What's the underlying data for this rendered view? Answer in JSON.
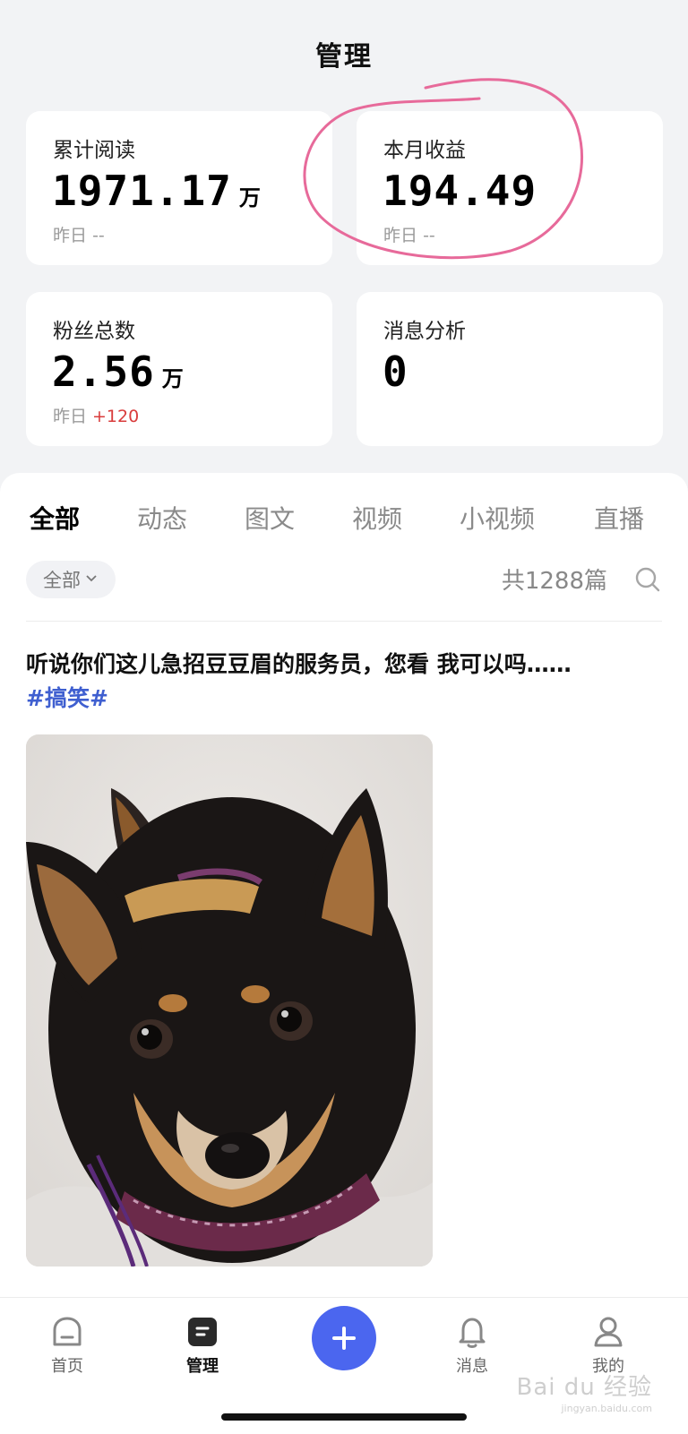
{
  "header": {
    "title": "管理"
  },
  "stats": {
    "reads": {
      "label": "累计阅读",
      "value": "1971.17",
      "unit": "万",
      "sub_label": "昨日",
      "sub_value": "--"
    },
    "income": {
      "label": "本月收益",
      "value": "194.49",
      "sub_label": "昨日",
      "sub_value": "--"
    },
    "fans": {
      "label": "粉丝总数",
      "value": "2.56",
      "unit": "万",
      "sub_label": "昨日",
      "sub_value": "+120"
    },
    "messages": {
      "label": "消息分析",
      "value": "0"
    }
  },
  "content": {
    "tabs": [
      {
        "label": "全部"
      },
      {
        "label": "动态"
      },
      {
        "label": "图文"
      },
      {
        "label": "视频"
      },
      {
        "label": "小视频"
      },
      {
        "label": "直播"
      }
    ],
    "filter_label": "全部",
    "count_text": "共1288篇",
    "post": {
      "title": "听说你们这儿急招豆豆眉的服务员，您看 我可以吗……",
      "tag": "#搞笑#"
    }
  },
  "tabbar": {
    "items": [
      {
        "label": "首页"
      },
      {
        "label": "管理"
      },
      {
        "label": "消息"
      },
      {
        "label": "我的"
      }
    ]
  },
  "watermark": {
    "text": "Bai du 经验",
    "url": "jingyan.baidu.com"
  },
  "colors": {
    "accent": "#4b66ef",
    "tag": "#3f5fd0",
    "delta": "#d93c3c",
    "annotation": "#e76a9a"
  }
}
